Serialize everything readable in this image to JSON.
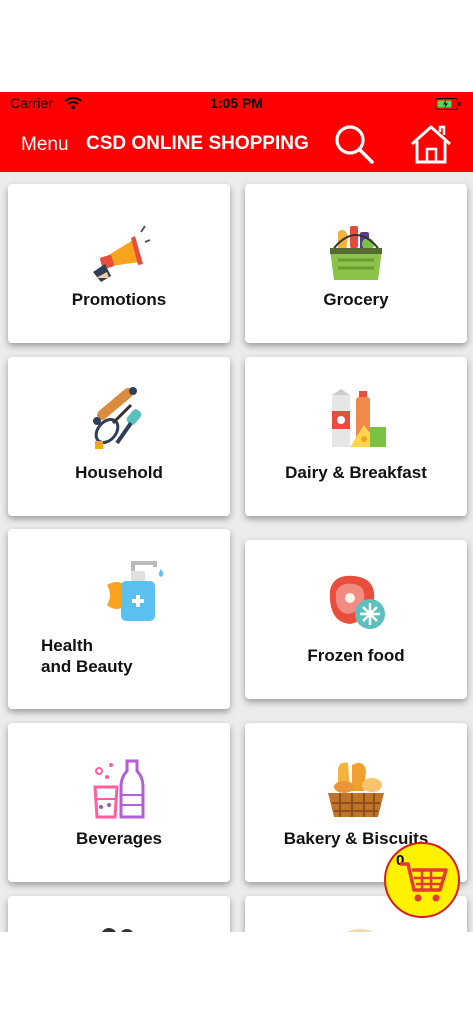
{
  "status": {
    "carrier": "Carrier",
    "time": "1:05 PM"
  },
  "nav": {
    "menu_label": "Menu",
    "title": "CSD ONLINE SHOPPING"
  },
  "categories": [
    {
      "label": "Promotions",
      "icon": "megaphone-icon"
    },
    {
      "label": "Grocery",
      "icon": "grocery-basket-icon"
    },
    {
      "label": "Household",
      "icon": "kitchen-utensils-icon"
    },
    {
      "label": "Dairy & Breakfast",
      "icon": "dairy-icon"
    },
    {
      "label": "Health\nand Beauty",
      "icon": "sanitizer-sponge-icon"
    },
    {
      "label": "Frozen food",
      "icon": "frozen-meat-icon"
    },
    {
      "label": "Beverages",
      "icon": "beverages-icon"
    },
    {
      "label": "Bakery & Biscuits",
      "icon": "bread-basket-icon"
    }
  ],
  "cart": {
    "count": "0"
  },
  "colors": {
    "brand": "#ff0000",
    "cart_fab": "#fff200"
  }
}
